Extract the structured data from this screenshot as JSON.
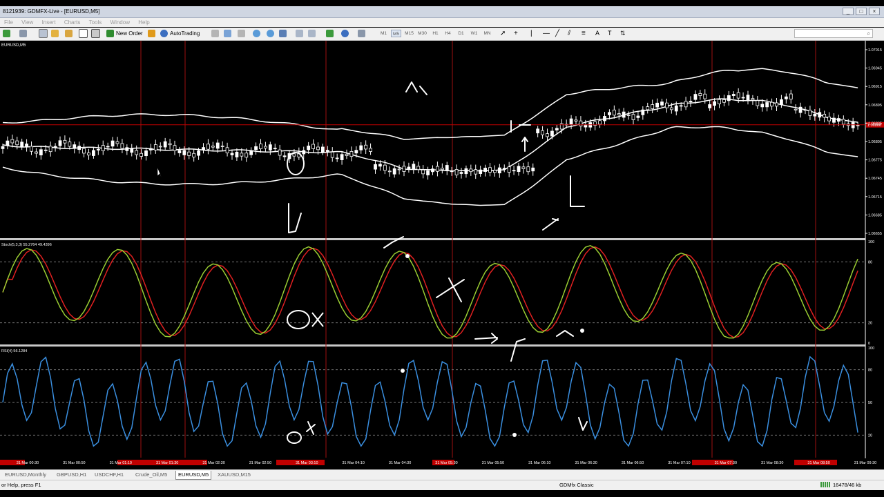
{
  "window": {
    "title": "8121939: GDMFX-Live - [EURUSD,M5]",
    "buttons": [
      "_",
      "□",
      "×"
    ]
  },
  "menu": [
    "File",
    "View",
    "Insert",
    "Charts",
    "Tools",
    "Window",
    "Help"
  ],
  "toolbar": {
    "new_order": "New Order",
    "autotrading": "AutoTrading",
    "timeframes": [
      "M1",
      "M5",
      "M15",
      "M30",
      "H1",
      "H4",
      "D1",
      "W1",
      "MN"
    ],
    "active_timeframe": "M5"
  },
  "chart": {
    "symbol_label": "EURUSD,M5",
    "price_levels": [
      "1.07015",
      "1.06945",
      "1.06915",
      "1.06895",
      "1.06835",
      "1.06805",
      "1.06775",
      "1.06745",
      "1.06715",
      "1.06685",
      "1.06655"
    ],
    "current_price": "1.06866",
    "stoch_label": "Stoch(5,3,3) 55.2764 49.4396",
    "stoch_levels": [
      "100",
      "80",
      "20",
      "0"
    ],
    "rsi_label": "RSI(4) 56.1284",
    "rsi_levels": [
      "100",
      "80",
      "50",
      "20"
    ],
    "time_labels": [
      "31 Mar 00:30",
      "31 Mar 00:50",
      "31 Mar 01:10",
      "31 Mar 01:30",
      "31 Mar 02:30",
      "31 Mar 02:50",
      "31 Mar 03:10",
      "31 Mar 04:10",
      "31 Mar 04:30",
      "31 Mar 05:30",
      "31 Mar 05:50",
      "31 Mar 06:10",
      "31 Mar 06:30",
      "31 Mar 06:50",
      "31 Mar 07:10",
      "31 Mar 07:30",
      "31 Mar 08:30",
      "31 Mar 08:50",
      "31 Mar 09:30"
    ],
    "colors": {
      "background": "#000000",
      "bollinger": "#ffffff",
      "stoch_main": "#9acd32",
      "stoch_signal": "#e02020",
      "rsi": "#3a8fe0",
      "vertical_lines": "#a01010",
      "current_price_line": "#c00000"
    }
  },
  "tabs": [
    "EURUSD,Monthly",
    "GBPUSD,H1",
    "USDCHF,H1",
    "Crude_Oil,M5",
    "EURUSD,M5",
    "XAUUSD,M15"
  ],
  "active_tab": "EURUSD,M5",
  "status": {
    "help": "or Help, press F1",
    "profile": "GDMfx Classic",
    "connection": "16478/46 kb"
  }
}
